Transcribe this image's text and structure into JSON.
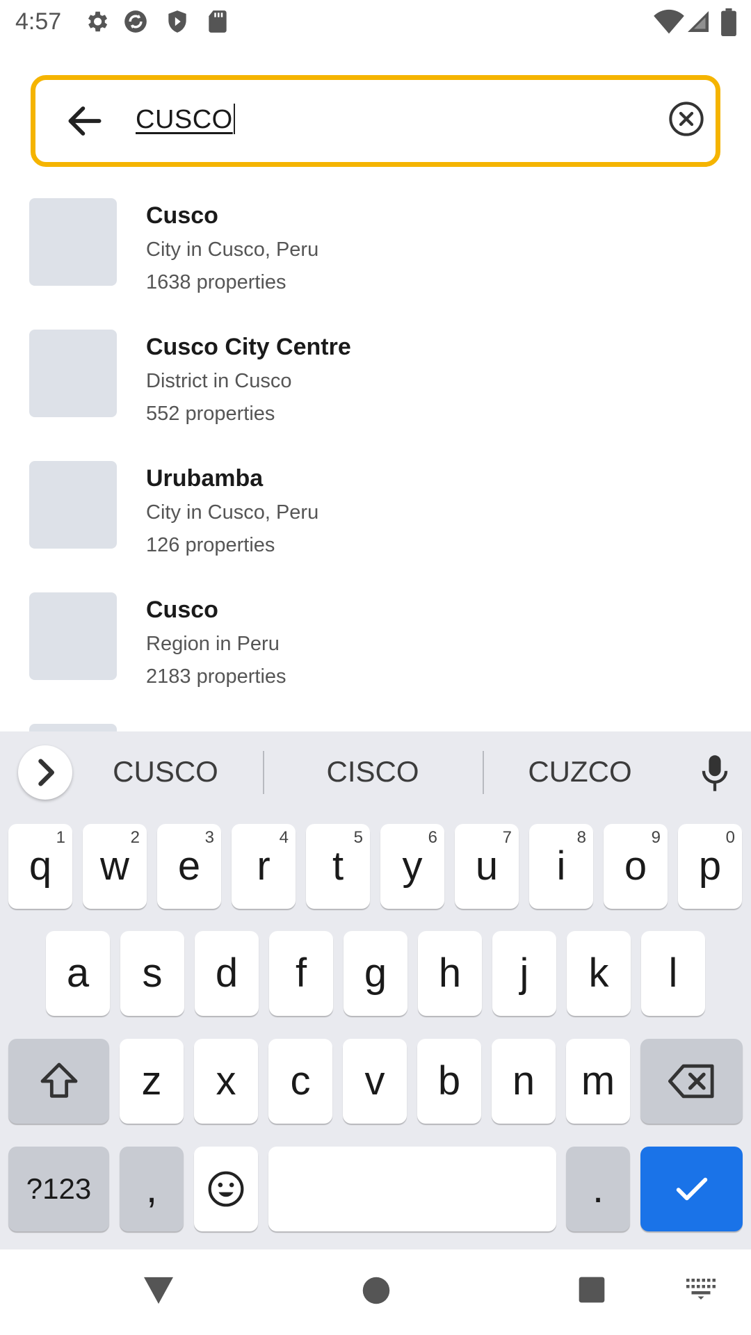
{
  "status_bar": {
    "time": "4:57",
    "icons_left": [
      "settings-gear-icon",
      "sync-icon",
      "shield-icon",
      "sd-card-icon"
    ],
    "icons_right": [
      "wifi-icon",
      "cell-signal-icon",
      "battery-icon"
    ]
  },
  "search": {
    "value": "CUSCO",
    "back_icon": "arrow-left-icon",
    "clear_icon": "clear-circle-x-icon",
    "border_color": "#f5b400"
  },
  "results": [
    {
      "title": "Cusco",
      "subtitle": "City in Cusco, Peru",
      "count": "1638 properties"
    },
    {
      "title": "Cusco City Centre",
      "subtitle": "District in Cusco",
      "count": "552 properties"
    },
    {
      "title": "Urubamba",
      "subtitle": "City in Cusco, Peru",
      "count": "126 properties"
    },
    {
      "title": "Cusco",
      "subtitle": "Region in Peru",
      "count": "2183 properties"
    }
  ],
  "keyboard": {
    "suggestions": [
      "CUSCO",
      "CISCO",
      "CUZCO"
    ],
    "row1": [
      {
        "k": "q",
        "h": "1"
      },
      {
        "k": "w",
        "h": "2"
      },
      {
        "k": "e",
        "h": "3"
      },
      {
        "k": "r",
        "h": "4"
      },
      {
        "k": "t",
        "h": "5"
      },
      {
        "k": "y",
        "h": "6"
      },
      {
        "k": "u",
        "h": "7"
      },
      {
        "k": "i",
        "h": "8"
      },
      {
        "k": "o",
        "h": "9"
      },
      {
        "k": "p",
        "h": "0"
      }
    ],
    "row2": [
      "a",
      "s",
      "d",
      "f",
      "g",
      "h",
      "j",
      "k",
      "l"
    ],
    "row3": [
      "z",
      "x",
      "c",
      "v",
      "b",
      "n",
      "m"
    ],
    "symbols_label": "?123",
    "comma_label": ",",
    "period_label": ".",
    "accent_color": "#1a73e8"
  },
  "nav_bar": {
    "icons": [
      "back-triangle-icon",
      "home-circle-icon",
      "recents-square-icon",
      "keyboard-switch-icon"
    ]
  }
}
